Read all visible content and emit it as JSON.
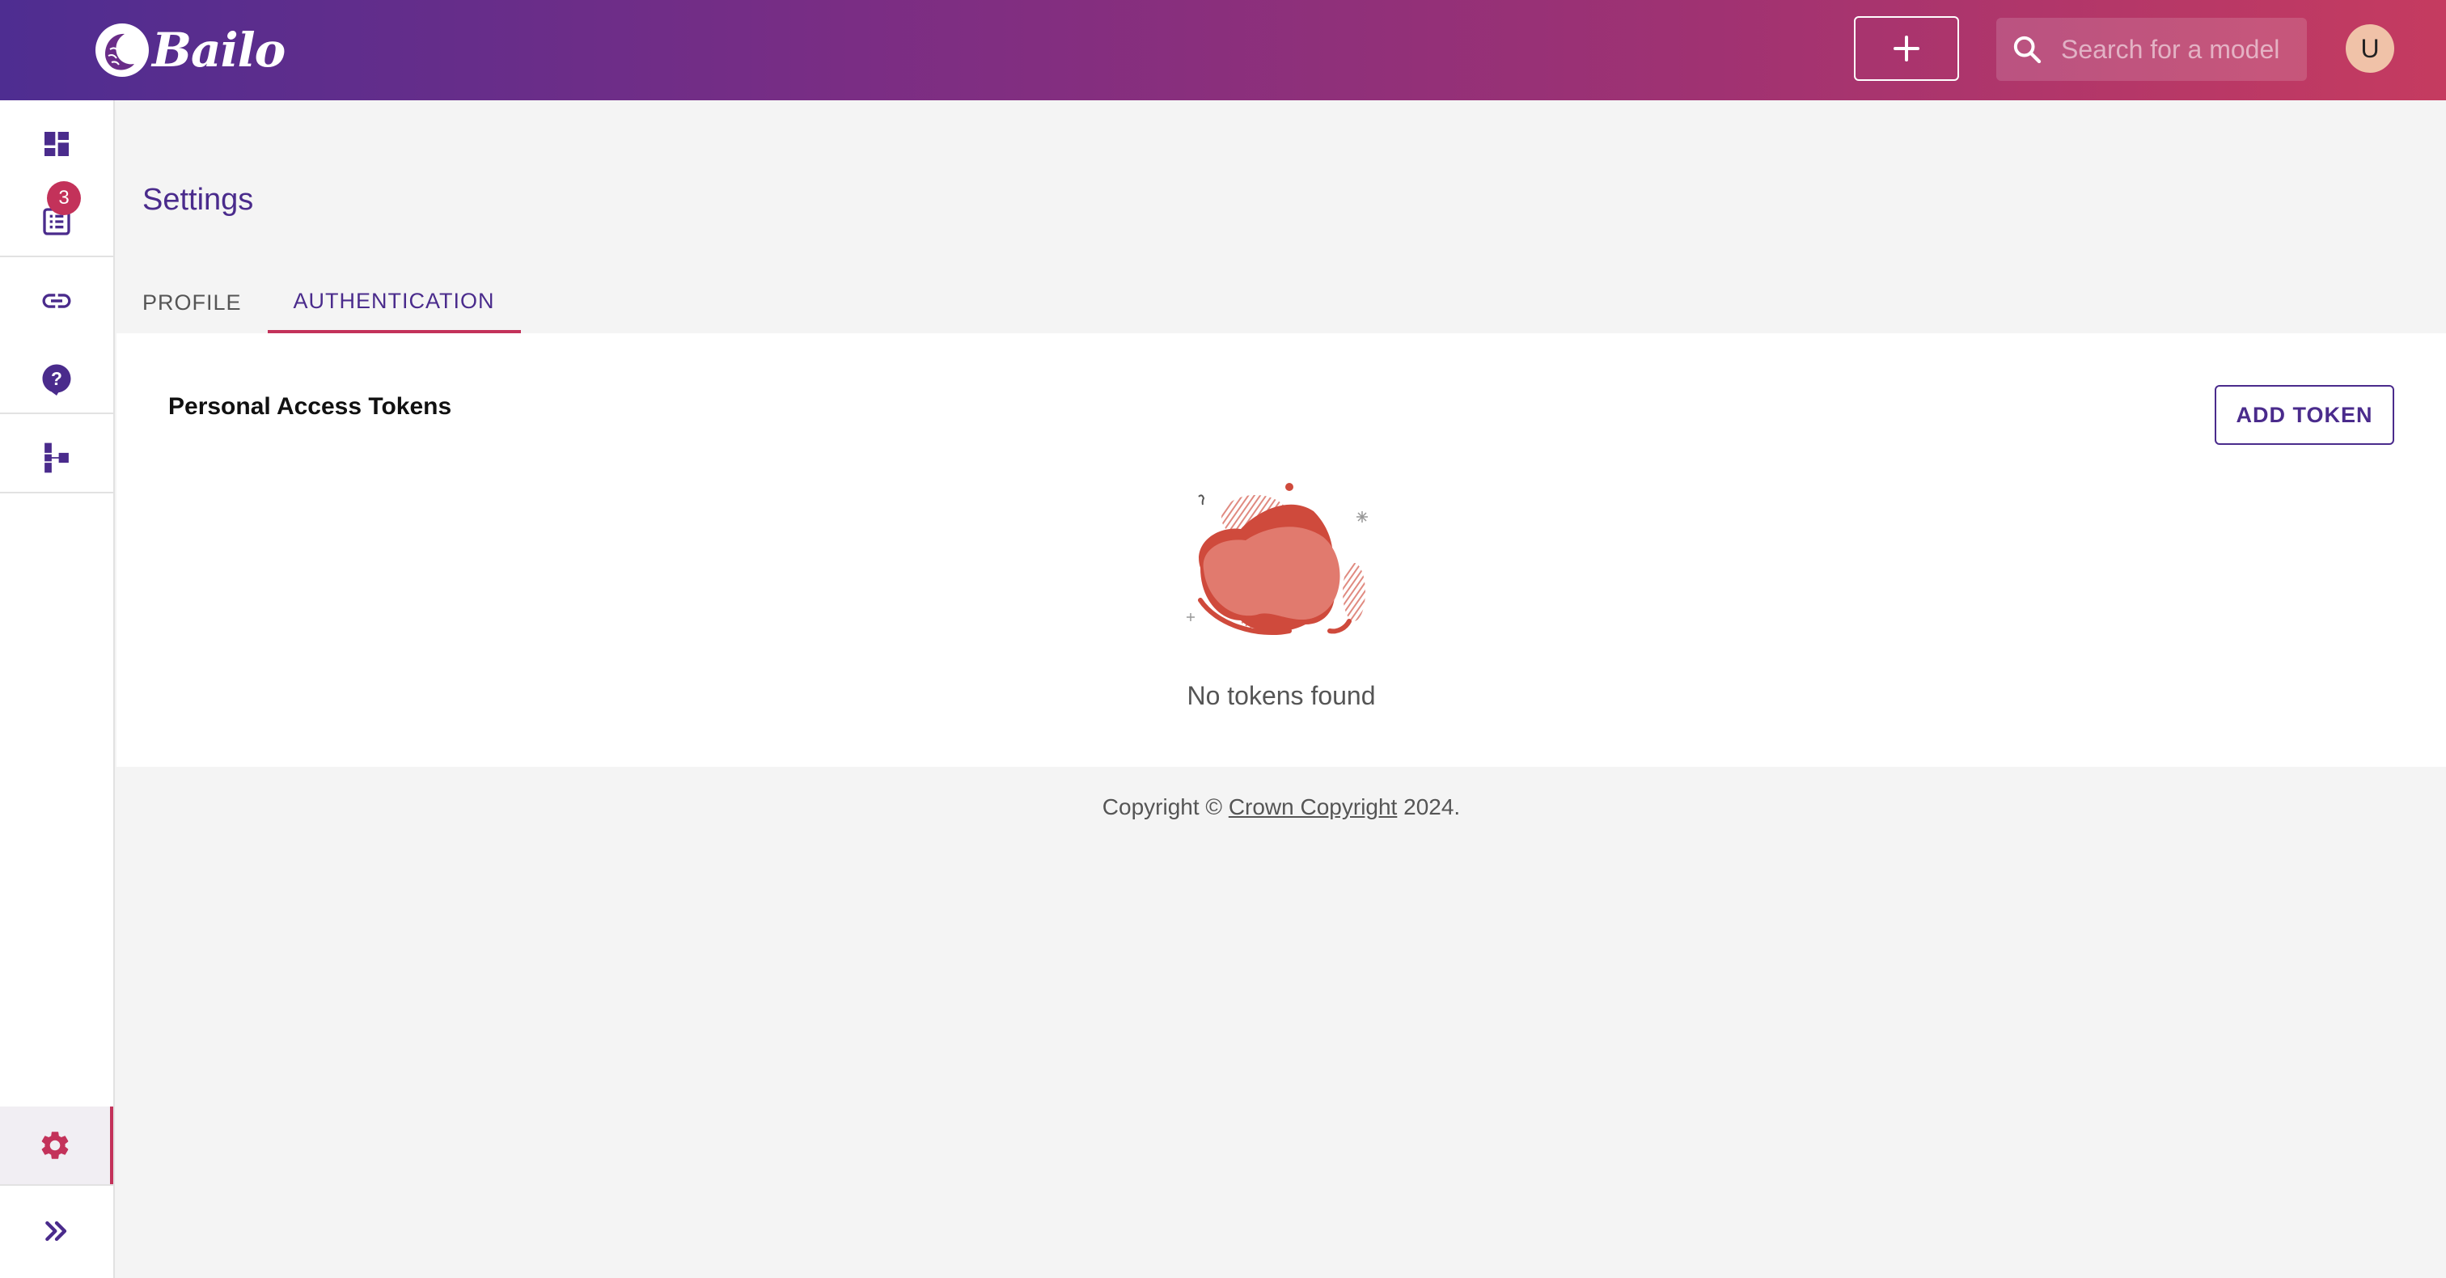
{
  "brand": {
    "name": "Bailo"
  },
  "header": {
    "add_icon": "plus-icon",
    "search": {
      "placeholder": "Search for a model",
      "value": ""
    },
    "avatar_initial": "U"
  },
  "sidebar": {
    "items": [
      {
        "name": "dashboard",
        "icon": "dashboard-icon"
      },
      {
        "name": "reviews",
        "icon": "list-icon",
        "badge": "3"
      },
      {
        "name": "links",
        "icon": "link-icon"
      },
      {
        "name": "help",
        "icon": "help-icon"
      },
      {
        "name": "schemas",
        "icon": "schema-icon"
      },
      {
        "name": "settings",
        "icon": "gear-icon",
        "active": true
      },
      {
        "name": "expand",
        "icon": "double-chevron-right-icon"
      }
    ]
  },
  "page": {
    "title": "Settings",
    "tabs": [
      {
        "label": "PROFILE",
        "active": false
      },
      {
        "label": "AUTHENTICATION",
        "active": true
      }
    ]
  },
  "tokens": {
    "title": "Personal Access Tokens",
    "add_button": "ADD TOKEN",
    "empty_message": "No tokens found"
  },
  "footer": {
    "prefix": "Copyright ©",
    "link": "Crown Copyright",
    "suffix": "2024."
  },
  "colors": {
    "primary": "#4a2b8c",
    "accent": "#c3325a",
    "gradient_start": "#4e2d91",
    "gradient_end": "#c53b60"
  }
}
